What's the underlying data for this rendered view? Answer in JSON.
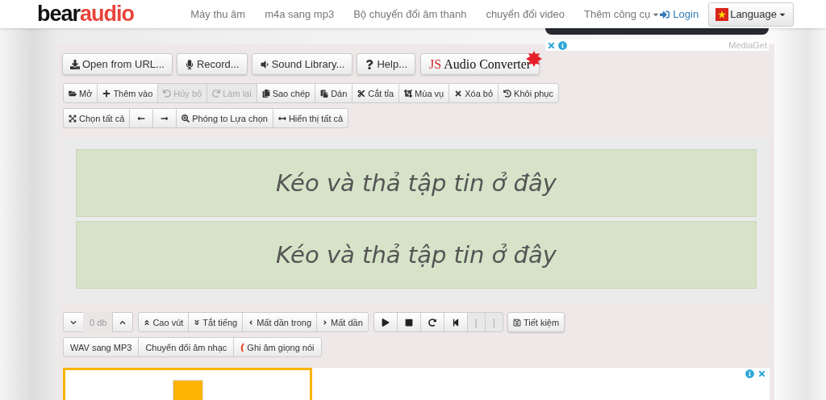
{
  "logo": {
    "part1": "bear",
    "part2": "audio"
  },
  "nav": [
    "Máy thu âm",
    "m4a sang mp3",
    "Bộ chuyển đổi âm thanh",
    "chuyển đổi video",
    "Thêm công cụ"
  ],
  "login": "Login",
  "language": "Language",
  "ad_top": {
    "label": "MediaGet"
  },
  "actions": [
    "Open from URL...",
    "Record...",
    "Sound Library...",
    "Help..."
  ],
  "js_logo": {
    "part1": "JS",
    "part2": "Audio Converter"
  },
  "edit_toolbar": [
    {
      "label": "Mở",
      "disabled": false
    },
    {
      "label": "Thêm vào",
      "disabled": false
    },
    {
      "label": "Hủy bỏ",
      "disabled": true
    },
    {
      "label": "Làm lại",
      "disabled": true
    },
    {
      "label": "Sao chép",
      "disabled": false
    },
    {
      "label": "Dán",
      "disabled": false
    },
    {
      "label": "Cắt tỉa",
      "disabled": false
    },
    {
      "label": "Mùa vụ",
      "disabled": false
    },
    {
      "label": "Xóa bỏ",
      "disabled": false
    },
    {
      "label": "Khôi phục",
      "disabled": false
    }
  ],
  "view_toolbar": [
    {
      "kind": "labeled",
      "label": "Chọn tất cả"
    },
    {
      "kind": "icon"
    },
    {
      "kind": "icon"
    },
    {
      "kind": "labeled",
      "label": "Phóng to Lựa chọn"
    },
    {
      "kind": "labeled",
      "label": "Hiển thị tất cả"
    }
  ],
  "tracks": [
    "Kéo và thả tập tin ở đây",
    "Kéo và thả tập tin ở đây"
  ],
  "volume": "0 db",
  "effects": [
    "Cao vút",
    "Tắt tiếng",
    "Mất dần trong",
    "Mất dần"
  ],
  "transport": [
    {
      "disabled": false
    },
    {
      "disabled": false
    },
    {
      "disabled": false
    },
    {
      "disabled": false
    }
  ],
  "markers": [
    {
      "label": "[",
      "disabled": true
    },
    {
      "label": "]",
      "disabled": true
    }
  ],
  "save": "Tiết kiệm",
  "links": [
    "WAV sang MP3",
    "Chuyển đổi âm nhạc",
    "Ghi âm giọng nói"
  ]
}
